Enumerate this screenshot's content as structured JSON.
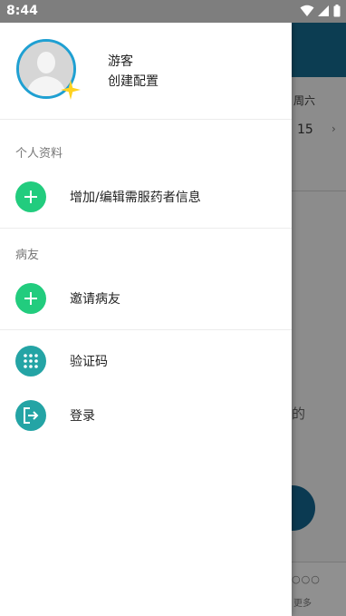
{
  "status_bar": {
    "time": "8:44"
  },
  "background": {
    "weekday": "周六",
    "date": "15",
    "partial_text": "的",
    "bottom_more": "更多"
  },
  "drawer": {
    "user": {
      "name": "游客",
      "config_link": "创建配置"
    },
    "sections": [
      {
        "title": "个人资料",
        "items": [
          {
            "label": "增加/编辑需服药者信息",
            "icon": "plus-icon"
          }
        ]
      },
      {
        "title": "病友",
        "items": [
          {
            "label": "邀请病友",
            "icon": "plus-icon"
          }
        ]
      }
    ],
    "extra_items": [
      {
        "label": "验证码",
        "icon": "dots-grid-icon"
      },
      {
        "label": "登录",
        "icon": "login-icon"
      }
    ]
  },
  "colors": {
    "accent_green": "#22cc7e",
    "accent_teal": "#24a4a5",
    "avatar_ring": "#1fa0d2",
    "star": "#ffd21f"
  }
}
